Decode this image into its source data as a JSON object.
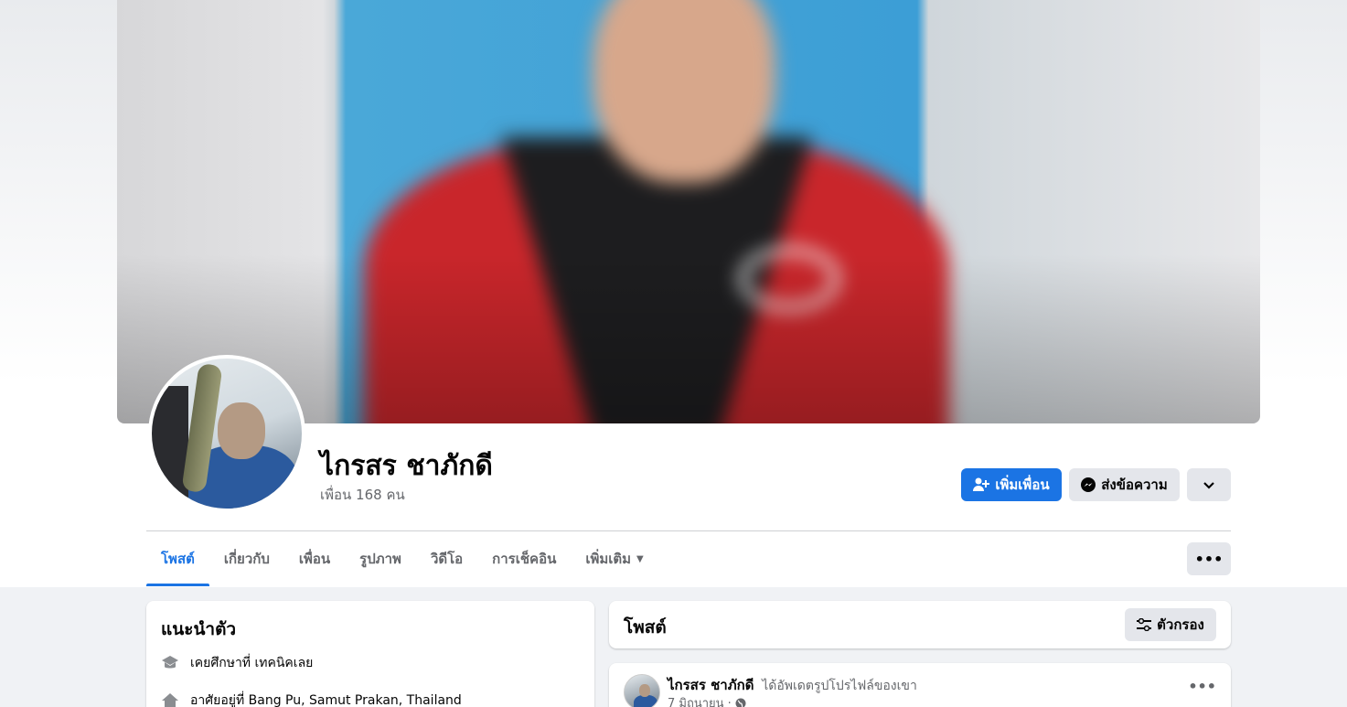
{
  "profile": {
    "name": "ไกรสร ชาภักดี",
    "friend_count": "เพื่อน 168 คน"
  },
  "actions": {
    "add_friend_label": "เพิ่มเพื่อน",
    "message_label": "ส่งข้อความ",
    "dropdown_icon": "chevron-down-icon"
  },
  "tabs": [
    {
      "label": "โพสต์",
      "active": true
    },
    {
      "label": "เกี่ยวกับ",
      "active": false
    },
    {
      "label": "เพื่อน",
      "active": false
    },
    {
      "label": "รูปภาพ",
      "active": false
    },
    {
      "label": "วิดีโอ",
      "active": false
    },
    {
      "label": "การเช็คอิน",
      "active": false
    },
    {
      "label": "เพิ่มเติม",
      "active": false
    }
  ],
  "tabs_more_icon": "ellipsis-icon",
  "intro": {
    "title": "แนะนำตัว",
    "items": [
      {
        "icon": "graduation-cap-icon",
        "text": "เคยศึกษาที่ เทคนิคเลย"
      },
      {
        "icon": "home-icon",
        "text": "อาศัยอยู่ที่ Bang Pu, Samut Prakan, Thailand"
      }
    ]
  },
  "posts": {
    "title": "โพสต์",
    "filter_label": "ตัวกรอง"
  },
  "post": {
    "author": "ไกรสร ชาภักดี",
    "action": "ได้อัพเดตรูปโปรไฟล์ของเขา",
    "date": "7 มิถุนายน ·",
    "privacy_icon": "globe-icon"
  },
  "colors": {
    "accent": "#1b74e4",
    "background": "#f0f2f5",
    "secondary_button": "#e4e6eb",
    "muted_text": "#65676b"
  }
}
